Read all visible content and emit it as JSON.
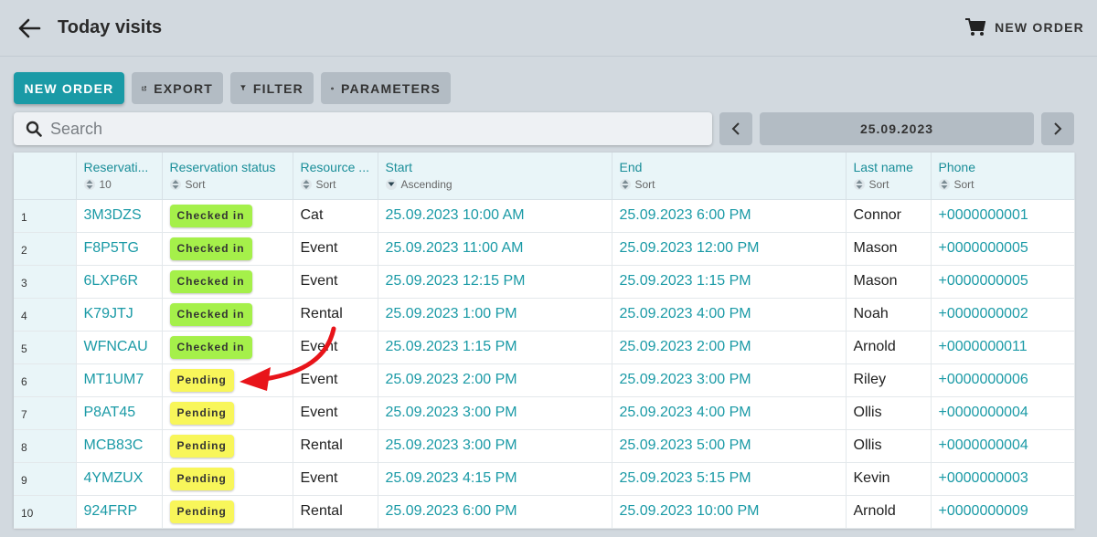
{
  "header": {
    "title": "Today visits",
    "new_order_label": "NEW ORDER"
  },
  "toolbar": {
    "new_order": "NEW ORDER",
    "export": "EXPORT",
    "filter": "FILTER",
    "parameters": "PARAMETERS"
  },
  "search": {
    "placeholder": "Search"
  },
  "date_nav": {
    "date": "25.09.2023"
  },
  "table": {
    "columns": [
      {
        "name": "Reservati...",
        "sort": "10"
      },
      {
        "name": "Reservation status",
        "sort": "Sort"
      },
      {
        "name": "Resource ...",
        "sort": "Sort"
      },
      {
        "name": "Start",
        "sort": "Ascending"
      },
      {
        "name": "End",
        "sort": "Sort"
      },
      {
        "name": "Last name",
        "sort": "Sort"
      },
      {
        "name": "Phone",
        "sort": "Sort"
      }
    ],
    "rows": [
      {
        "n": "1",
        "code": "3M3DZS",
        "status": "Checked in",
        "resource": "Cat",
        "start": "25.09.2023 10:00 AM",
        "end": "25.09.2023 6:00 PM",
        "last": "Connor",
        "phone": "+0000000001"
      },
      {
        "n": "2",
        "code": "F8P5TG",
        "status": "Checked in",
        "resource": "Event",
        "start": "25.09.2023 11:00 AM",
        "end": "25.09.2023 12:00 PM",
        "last": "Mason",
        "phone": "+0000000005"
      },
      {
        "n": "3",
        "code": "6LXP6R",
        "status": "Checked in",
        "resource": "Event",
        "start": "25.09.2023 12:15 PM",
        "end": "25.09.2023 1:15 PM",
        "last": "Mason",
        "phone": "+0000000005"
      },
      {
        "n": "4",
        "code": "K79JTJ",
        "status": "Checked in",
        "resource": "Rental",
        "start": "25.09.2023 1:00 PM",
        "end": "25.09.2023 4:00 PM",
        "last": "Noah",
        "phone": "+0000000002"
      },
      {
        "n": "5",
        "code": "WFNCAU",
        "status": "Checked in",
        "resource": "Event",
        "start": "25.09.2023 1:15 PM",
        "end": "25.09.2023 2:00 PM",
        "last": "Arnold",
        "phone": "+0000000011"
      },
      {
        "n": "6",
        "code": "MT1UM7",
        "status": "Pending",
        "resource": "Event",
        "start": "25.09.2023 2:00 PM",
        "end": "25.09.2023 3:00 PM",
        "last": "Riley",
        "phone": "+0000000006"
      },
      {
        "n": "7",
        "code": "P8AT45",
        "status": "Pending",
        "resource": "Event",
        "start": "25.09.2023 3:00 PM",
        "end": "25.09.2023 4:00 PM",
        "last": "Ollis",
        "phone": "+0000000004"
      },
      {
        "n": "8",
        "code": "MCB83C",
        "status": "Pending",
        "resource": "Rental",
        "start": "25.09.2023 3:00 PM",
        "end": "25.09.2023 5:00 PM",
        "last": "Ollis",
        "phone": "+0000000004"
      },
      {
        "n": "9",
        "code": "4YMZUX",
        "status": "Pending",
        "resource": "Event",
        "start": "25.09.2023 4:15 PM",
        "end": "25.09.2023 5:15 PM",
        "last": "Kevin",
        "phone": "+0000000003"
      },
      {
        "n": "10",
        "code": "924FRP",
        "status": "Pending",
        "resource": "Rental",
        "start": "25.09.2023 6:00 PM",
        "end": "25.09.2023 10:00 PM",
        "last": "Arnold",
        "phone": "+0000000009"
      }
    ]
  },
  "colors": {
    "accent": "#1a9aa6",
    "checked_in": "#a5f04a",
    "pending": "#f8f65a",
    "annotation_arrow": "#e8141a"
  },
  "icons": {
    "back": "arrow-left-icon",
    "cart": "shopping-cart-icon",
    "export": "external-link-icon",
    "filter": "funnel-icon",
    "parameters": "gear-icon",
    "search": "search-icon",
    "prev": "chevron-left-icon",
    "next": "chevron-right-icon"
  }
}
